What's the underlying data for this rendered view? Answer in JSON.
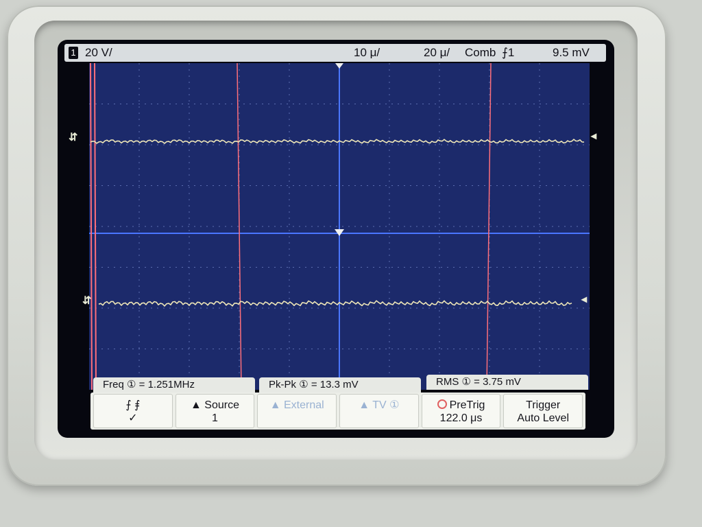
{
  "status_bar": {
    "channel": "1",
    "ch1_scale": "20 V/",
    "time_scale": "10 μ/",
    "time_delay": "20 μ/",
    "trigger_mode": "Comb",
    "trigger_edge": "⨍1",
    "trigger_level": "9.5 mV"
  },
  "markers": {
    "trace_left": "⇵",
    "trace_right": "◂"
  },
  "measurements": {
    "freq_label": "Freq",
    "freq_value": "1.251MHz",
    "pkpk_label": "Pk-Pk",
    "pkpk_value": "13.3 mV",
    "rms_label": "RMS",
    "rms_value": "3.75 mV",
    "equals": "=",
    "circled": "①"
  },
  "softkeys": [
    {
      "line1": "⨍   ⨎",
      "line2": "✓"
    },
    {
      "line1": "▲ Source",
      "line2": "1"
    },
    {
      "line1": "▲ External",
      "line2": ""
    },
    {
      "line1": "▲ TV ①",
      "line2": ""
    },
    {
      "line1": "PreTrig",
      "line2": "122.0 μs"
    },
    {
      "line1": "Trigger",
      "line2": "Auto Level"
    }
  ],
  "colors": {
    "grid_bg": "#1c2a6b",
    "trace": "#efe7b8",
    "cursor": "#ff6f7a",
    "axis": "#4a76ff"
  }
}
